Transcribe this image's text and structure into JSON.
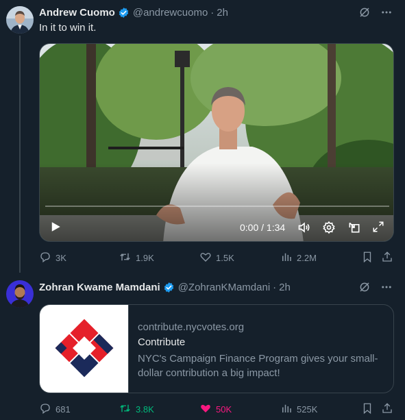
{
  "colors": {
    "background": "#15202b",
    "text": "#e7e9ea",
    "muted": "#8b98a5",
    "verified": "#1d9bf0",
    "retweet_active": "#00ba7c",
    "like_active": "#f91880"
  },
  "tweets": [
    {
      "author": "Andrew Cuomo",
      "handle": "@andrewcuomo",
      "separator": "·",
      "time": "2h",
      "text": "In it to win it.",
      "video": {
        "time_display": "0:00 / 1:34",
        "progress": 0.0
      },
      "stats": {
        "replies": "3K",
        "retweets": "1.9K",
        "likes": "1.5K",
        "views": "2.2M"
      }
    },
    {
      "author": "Zohran Kwame Mamdani",
      "handle": "@ZohranKMamdani",
      "separator": "·",
      "time": "2h",
      "card": {
        "domain": "contribute.nycvotes.org",
        "title": "Contribute",
        "description": "NYC's Campaign Finance Program gives your small-dollar contribution a big impact!"
      },
      "stats": {
        "replies": "681",
        "retweets": "3.8K",
        "likes": "50K",
        "views": "525K"
      }
    }
  ]
}
